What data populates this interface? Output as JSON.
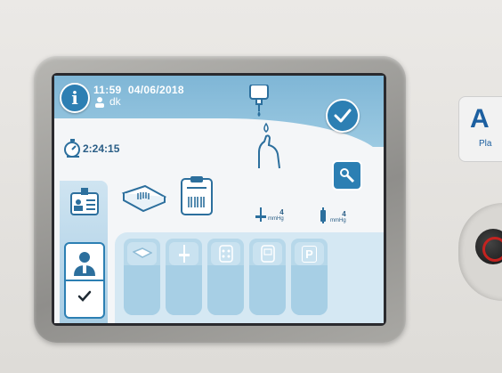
{
  "status_bar": {
    "time": "11:59",
    "date": "04/06/2018",
    "user": "dk",
    "elapsed": "2:24:15"
  },
  "pressures": [
    {
      "value": "4",
      "unit": "mmHg"
    },
    {
      "value": "4",
      "unit": "mmHg"
    }
  ],
  "device": {
    "logo_letter": "A",
    "logo_sub": "Pla"
  },
  "colors": {
    "accent": "#2c7fb3",
    "header": "#8fc2de",
    "tray": "#d5e8f3",
    "knob_ring": "#c42320"
  },
  "icons": {
    "info": "info-icon",
    "confirm": "checkmark-icon",
    "clock": "stopwatch-icon",
    "bag": "bag-icon",
    "hand": "hand-drop-icon",
    "tool": "tool-icon",
    "badge": "id-badge-icon",
    "tray": "tray-barcode-icon",
    "clipboard": "clipboard-barcode-icon",
    "user": "operator-icon"
  },
  "steps": [
    {
      "icon": "tray-icon"
    },
    {
      "icon": "needle-icon"
    },
    {
      "icon": "bag-grid-icon"
    },
    {
      "icon": "bag-display-icon"
    },
    {
      "icon": "bag-p-icon"
    }
  ],
  "steps_labels": [
    "",
    "",
    "",
    "",
    "P"
  ]
}
